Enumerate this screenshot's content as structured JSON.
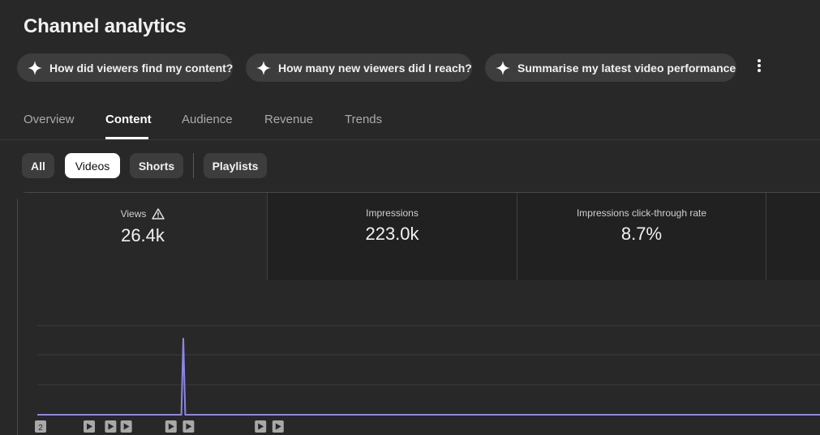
{
  "page": {
    "title": "Channel analytics"
  },
  "suggestions": [
    {
      "label": "How did viewers find my content?",
      "icon": "sparkle-icon"
    },
    {
      "label": "How many new viewers did I reach?",
      "icon": "sparkle-icon"
    },
    {
      "label": "Summarise my latest video performance",
      "icon": "sparkle-icon"
    }
  ],
  "more_menu": {
    "icon": "more-vertical-icon"
  },
  "tabs": [
    {
      "label": "Overview",
      "active": false
    },
    {
      "label": "Content",
      "active": true
    },
    {
      "label": "Audience",
      "active": false
    },
    {
      "label": "Revenue",
      "active": false
    },
    {
      "label": "Trends",
      "active": false
    }
  ],
  "filters": [
    {
      "label": "All",
      "selected": false
    },
    {
      "label": "Videos",
      "selected": true
    },
    {
      "label": "Shorts",
      "selected": false
    },
    {
      "label": "Playlists",
      "selected": false
    }
  ],
  "metrics": [
    {
      "label": "Views",
      "value": "26.4k",
      "selected": true,
      "warning_icon": "warning-triangle-icon"
    },
    {
      "label": "Impressions",
      "value": "223.0k",
      "selected": false
    },
    {
      "label": "Impressions click-through rate",
      "value": "8.7%",
      "selected": false
    }
  ],
  "colors": {
    "background": "#282828",
    "line": "#8c86e6",
    "marker": "#a8a8a8"
  },
  "chart_data": {
    "type": "line",
    "title": "",
    "xlabel": "",
    "ylabel": "",
    "grid": true,
    "series": [
      {
        "values": [
          0,
          0,
          0,
          0,
          0,
          0,
          0,
          0,
          0,
          0,
          0,
          0,
          0,
          0,
          0,
          0,
          0,
          0,
          0,
          0,
          0,
          0,
          0,
          0,
          0,
          0,
          0,
          0,
          0,
          0,
          0,
          0,
          0,
          0,
          0,
          0,
          0,
          0,
          0,
          0,
          0,
          0,
          0,
          0,
          0,
          0,
          0,
          0,
          0,
          0,
          0,
          0,
          0,
          0,
          0,
          0,
          0,
          0,
          0,
          0,
          0,
          0,
          0,
          0,
          0,
          0,
          0,
          0,
          0,
          0,
          0,
          0,
          0,
          0,
          0,
          0,
          0,
          0,
          0,
          0,
          0,
          0,
          0,
          0,
          0,
          0,
          0,
          0,
          0,
          0,
          0,
          0,
          0,
          0,
          0,
          0,
          0,
          0,
          0,
          0,
          0,
          0,
          0,
          0,
          0,
          0,
          0,
          0,
          0,
          0,
          0,
          0,
          0,
          0,
          0,
          0,
          0,
          0,
          0,
          0,
          0,
          0,
          0,
          0,
          0,
          0,
          0,
          0,
          0,
          0,
          0,
          0,
          0,
          0,
          0,
          0,
          0,
          0,
          0,
          0,
          0,
          0,
          0,
          0,
          0,
          0,
          0,
          0,
          0,
          0,
          0,
          0,
          0,
          0,
          0,
          0,
          0,
          0,
          0,
          0,
          0,
          0,
          0,
          0,
          0,
          0,
          0,
          0,
          0,
          0,
          0,
          0,
          0,
          0,
          0,
          0,
          0,
          0,
          0,
          0,
          0,
          0,
          0,
          0,
          0,
          0,
          0,
          0,
          0,
          0,
          0,
          0,
          0,
          0,
          0,
          0,
          0,
          0,
          0,
          0,
          0,
          0,
          0,
          0,
          0,
          0,
          0,
          0,
          0,
          0,
          0,
          0,
          0,
          0,
          0,
          0,
          0,
          0,
          0,
          0,
          0,
          0,
          0,
          0,
          0,
          0,
          0,
          0,
          0,
          0,
          0,
          0,
          0,
          0,
          0,
          0,
          0,
          0,
          0,
          0,
          0,
          0,
          0,
          0,
          0,
          0,
          0,
          0,
          0,
          0,
          0,
          0,
          0,
          0,
          0,
          0,
          0,
          0,
          0,
          0,
          0,
          0,
          0,
          0,
          0,
          0,
          0,
          0,
          0,
          0,
          0,
          0,
          0,
          0,
          0,
          0,
          0,
          0,
          0,
          0,
          0,
          0,
          0,
          0,
          0,
          0,
          0,
          0,
          0,
          0,
          0,
          0,
          0,
          0,
          0,
          0,
          0,
          0,
          0,
          0,
          0,
          0,
          0,
          0,
          0,
          0,
          0,
          0,
          0,
          0,
          0,
          0,
          0,
          0,
          0,
          0,
          0,
          0,
          0,
          0,
          0,
          0,
          0,
          0,
          0,
          0,
          0,
          0,
          0,
          0,
          0,
          0,
          0,
          0,
          0,
          0,
          0,
          0,
          0,
          0,
          0,
          0,
          0,
          0,
          0,
          0,
          0,
          0,
          0,
          0,
          0,
          0,
          0,
          0,
          0,
          0,
          0,
          0,
          0
        ]
      }
    ],
    "peak": {
      "index": 75,
      "value": 1
    },
    "video_markers": [
      {
        "index": 0,
        "label": "2"
      },
      {
        "index": 25,
        "label": ""
      },
      {
        "index": 36,
        "label": ""
      },
      {
        "index": 44,
        "label": ""
      },
      {
        "index": 67,
        "label": ""
      },
      {
        "index": 76,
        "label": ""
      },
      {
        "index": 113,
        "label": ""
      },
      {
        "index": 122,
        "label": ""
      }
    ]
  }
}
